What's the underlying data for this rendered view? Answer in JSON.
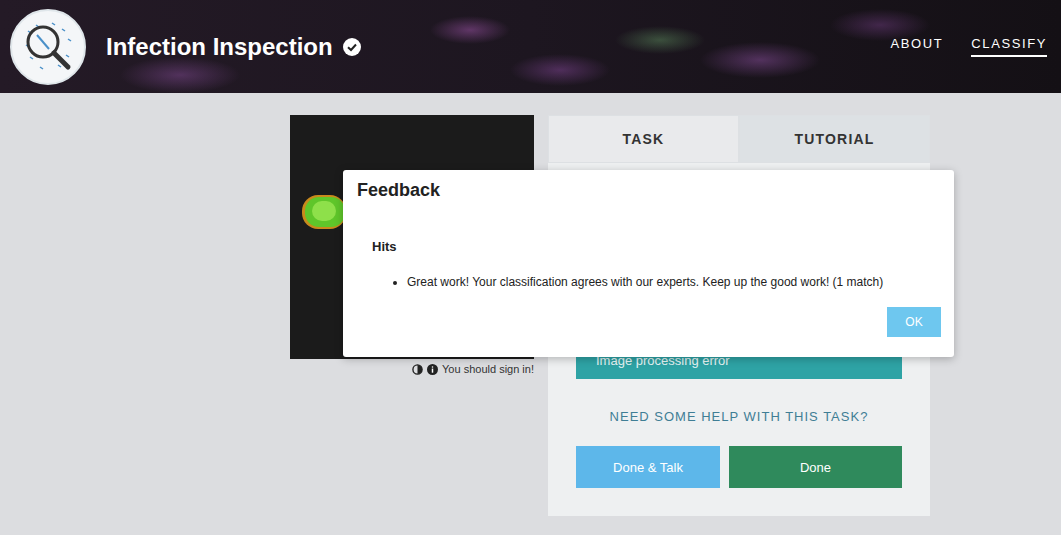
{
  "header": {
    "title": "Infection Inspection",
    "verified": true,
    "nav": [
      {
        "label": "ABOUT",
        "selected": false
      },
      {
        "label": "CLASSIFY",
        "selected": true
      }
    ]
  },
  "subject": {
    "note": "You should sign in!"
  },
  "task_panel": {
    "tabs": [
      {
        "label": "TASK",
        "selected": true
      },
      {
        "label": "TUTORIAL",
        "selected": false
      }
    ],
    "answers": [
      "Image processing error"
    ],
    "help": "NEED SOME HELP WITH THIS TASK?",
    "buttons": [
      "Done & Talk",
      "Done"
    ]
  },
  "dialog": {
    "title": "Feedback",
    "section": "Hits",
    "items": [
      "Great work! Your classification agrees with our experts. Keep up the good work! (1 match)"
    ],
    "buttons": [
      "OK"
    ]
  }
}
